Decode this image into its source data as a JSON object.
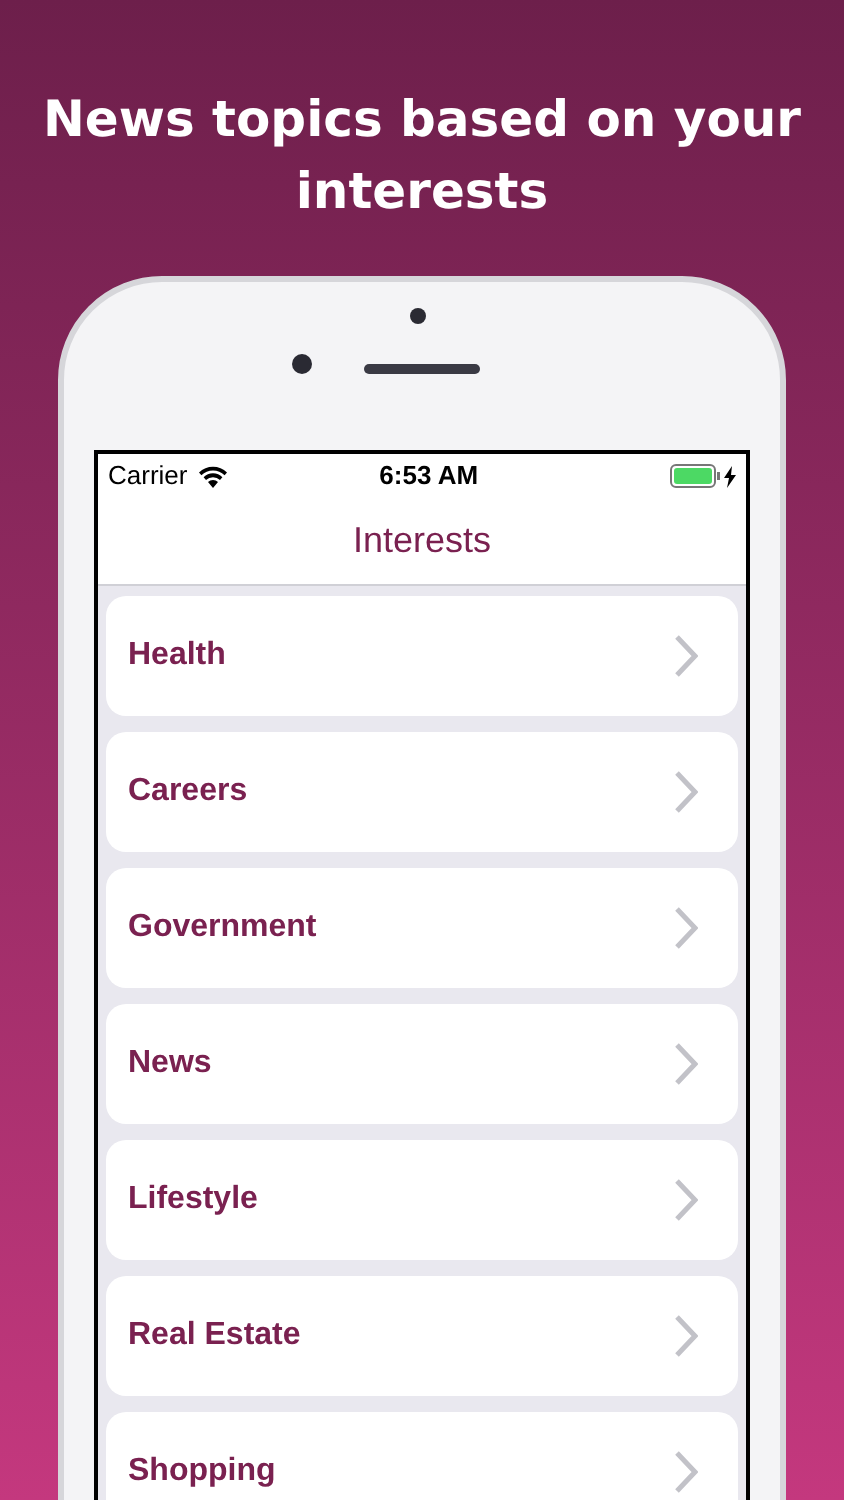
{
  "headline": "News topics based on your interests",
  "status_bar": {
    "carrier": "Carrier",
    "time": "6:53 AM",
    "battery_charging": true
  },
  "nav": {
    "title": "Interests"
  },
  "interests": [
    {
      "label": "Health"
    },
    {
      "label": "Careers"
    },
    {
      "label": "Government"
    },
    {
      "label": "News"
    },
    {
      "label": "Lifestyle"
    },
    {
      "label": "Real Estate"
    },
    {
      "label": "Shopping"
    }
  ]
}
